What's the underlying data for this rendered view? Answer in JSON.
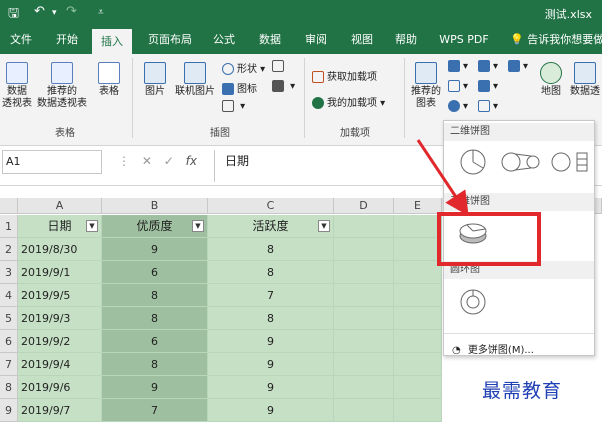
{
  "titlebar": {
    "title": "测试.xlsx"
  },
  "tabs": [
    "文件",
    "开始",
    "插入",
    "页面布局",
    "公式",
    "数据",
    "审阅",
    "视图",
    "帮助",
    "WPS PDF"
  ],
  "active_tab": "插入",
  "tellme": "告诉我你想要做什么",
  "ribbon": {
    "table_group": {
      "label": "表格",
      "pivot": [
        "数据",
        "透视表"
      ],
      "recommended_pivot": [
        "推荐的",
        "数据透视表"
      ],
      "table": "表格"
    },
    "illustrations_group": {
      "label": "插图",
      "picture": "图片",
      "online_picture": "联机图片",
      "shapes": "形状",
      "icons": "图标"
    },
    "addins_group": {
      "label": "加载项",
      "get_addins": "获取加载项",
      "my_addins": "我的加载项"
    },
    "charts": {
      "recommended": [
        "推荐的",
        "图表"
      ],
      "map": "地图",
      "pivot_chart": [
        "数据透"
      ]
    }
  },
  "formula_bar": {
    "name_box": "A1",
    "content": "日期"
  },
  "grid": {
    "columns": [
      "A",
      "B",
      "C",
      "D",
      "E"
    ],
    "headers": [
      "日期",
      "优质度",
      "活跃度"
    ],
    "rows": [
      {
        "n": "1"
      },
      {
        "n": "2",
        "date": "2019/8/30",
        "quality": "9",
        "activity": "8"
      },
      {
        "n": "3",
        "date": "2019/9/1",
        "quality": "6",
        "activity": "8"
      },
      {
        "n": "4",
        "date": "2019/9/5",
        "quality": "8",
        "activity": "7"
      },
      {
        "n": "5",
        "date": "2019/9/3",
        "quality": "8",
        "activity": "8"
      },
      {
        "n": "6",
        "date": "2019/9/2",
        "quality": "6",
        "activity": "9"
      },
      {
        "n": "7",
        "date": "2019/9/4",
        "quality": "8",
        "activity": "9"
      },
      {
        "n": "8",
        "date": "2019/9/6",
        "quality": "9",
        "activity": "9"
      },
      {
        "n": "9",
        "date": "2019/9/7",
        "quality": "7",
        "activity": "9"
      }
    ]
  },
  "pie_menu": {
    "section_2d": "二维饼图",
    "section_3d": "三维饼图",
    "section_donut": "圆环图",
    "more": "更多饼图(M)..."
  },
  "watermark": "最需教育",
  "colors": {
    "accent": "#217346",
    "highlight": "#e0282d",
    "watermark": "#1e3fb5"
  }
}
